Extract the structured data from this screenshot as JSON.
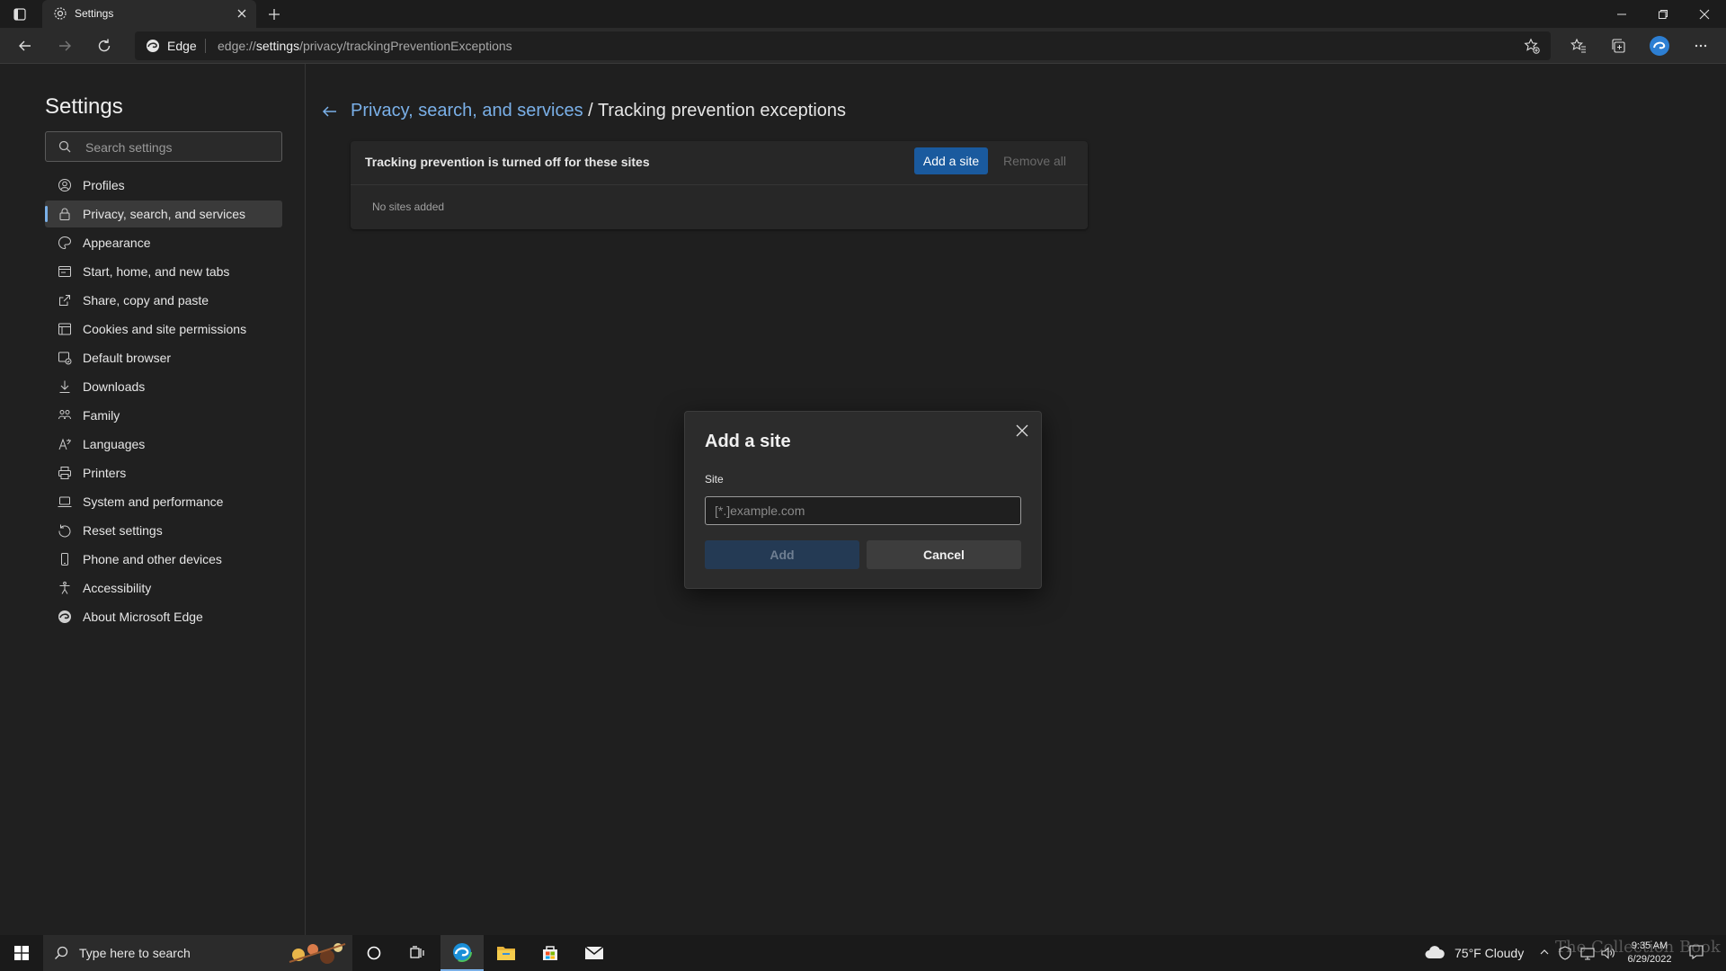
{
  "browser": {
    "tab_title": "Settings",
    "edge_label": "Edge",
    "url_prefix": "edge://",
    "url_bold": "settings",
    "url_rest": "/privacy/trackingPreventionExceptions"
  },
  "sidebar": {
    "title": "Settings",
    "search_placeholder": "Search settings",
    "items": [
      {
        "label": "Profiles",
        "icon": "profile-icon"
      },
      {
        "label": "Privacy, search, and services",
        "icon": "lock-icon",
        "active": true
      },
      {
        "label": "Appearance",
        "icon": "appearance-icon"
      },
      {
        "label": "Start, home, and new tabs",
        "icon": "home-tabs-icon"
      },
      {
        "label": "Share, copy and paste",
        "icon": "share-icon"
      },
      {
        "label": "Cookies and site permissions",
        "icon": "cookies-icon"
      },
      {
        "label": "Default browser",
        "icon": "browser-icon"
      },
      {
        "label": "Downloads",
        "icon": "download-icon"
      },
      {
        "label": "Family",
        "icon": "family-icon"
      },
      {
        "label": "Languages",
        "icon": "language-icon"
      },
      {
        "label": "Printers",
        "icon": "printer-icon"
      },
      {
        "label": "System and performance",
        "icon": "laptop-icon"
      },
      {
        "label": "Reset settings",
        "icon": "reset-icon"
      },
      {
        "label": "Phone and other devices",
        "icon": "phone-icon"
      },
      {
        "label": "Accessibility",
        "icon": "accessibility-icon"
      },
      {
        "label": "About Microsoft Edge",
        "icon": "edge-logo-icon"
      }
    ]
  },
  "main": {
    "breadcrumb_link": "Privacy, search, and services",
    "breadcrumb_sep": " / ",
    "breadcrumb_current": "Tracking prevention exceptions",
    "card_heading": "Tracking prevention is turned off for these sites",
    "add_site_label": "Add a site",
    "remove_all_label": "Remove all",
    "empty_text": "No sites added"
  },
  "dialog": {
    "title": "Add a site",
    "field_label": "Site",
    "input_placeholder": "[*.]example.com",
    "input_value": "",
    "add_label": "Add",
    "cancel_label": "Cancel"
  },
  "taskbar": {
    "search_placeholder": "Type here to search",
    "weather": "75°F  Cloudy",
    "time": "9:35 AM",
    "date": "6/29/2022",
    "watermark": "The Collection Book"
  },
  "colors": {
    "accent": "#7ab0e8",
    "primary_button": "#1a5a9e",
    "background": "#1f1f1f"
  }
}
